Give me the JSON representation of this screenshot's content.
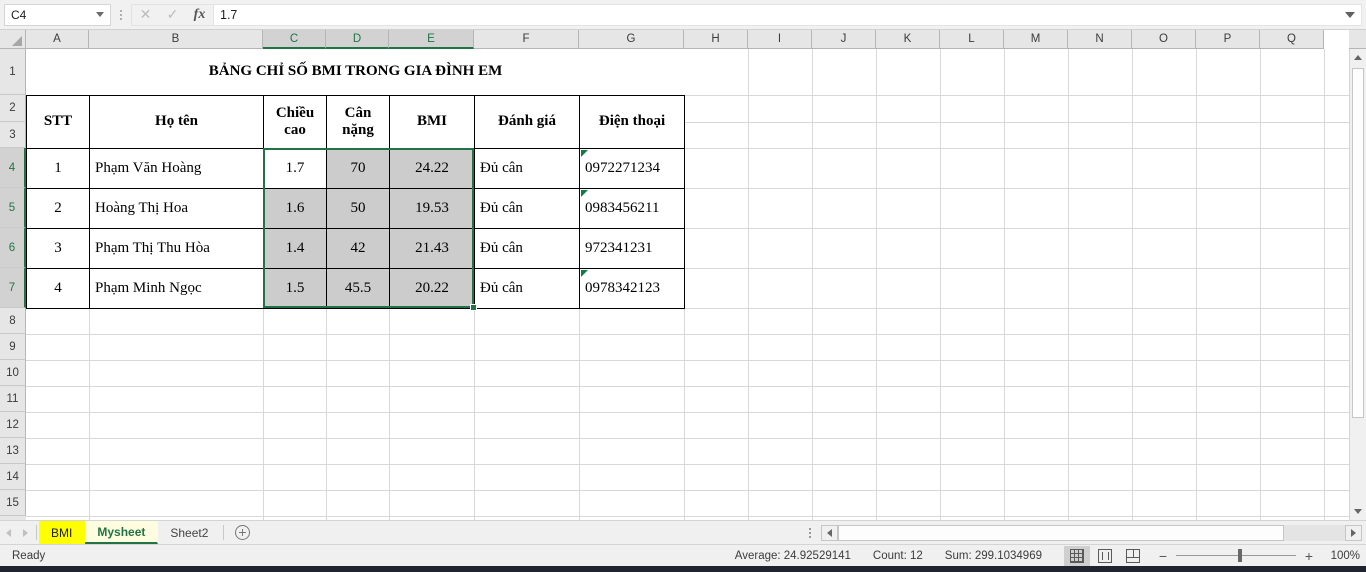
{
  "formula_bar": {
    "name_box_value": "C4",
    "formula_value": "1.7",
    "cancel_icon": "close-icon",
    "confirm_icon": "check-icon",
    "function_icon": "fx-icon"
  },
  "grid": {
    "column_headers": [
      "A",
      "B",
      "C",
      "D",
      "E",
      "F",
      "G",
      "H",
      "I",
      "J",
      "K",
      "L",
      "M",
      "N",
      "O",
      "P",
      "Q"
    ],
    "selected_columns": [
      "C",
      "D",
      "E"
    ],
    "row_headers": [
      "1",
      "2",
      "3",
      "4",
      "5",
      "6",
      "7",
      "8",
      "9",
      "10",
      "11",
      "12",
      "13",
      "14",
      "15"
    ],
    "selected_rows": [
      "4",
      "5",
      "6",
      "7"
    ]
  },
  "sheet": {
    "title": "BẢNG CHỈ SỐ BMI TRONG GIA ĐÌNH EM",
    "headers": [
      "STT",
      "Họ tên",
      "Chiều cao",
      "Cân nặng",
      "BMI",
      "Đánh giá",
      "Điện thoại"
    ],
    "rows": [
      {
        "stt": "1",
        "name": "Phạm Văn Hoàng",
        "height": "1.7",
        "weight": "70",
        "bmi": "24.22",
        "rating": "Đủ cân",
        "phone": "0972271234",
        "phone_error": true
      },
      {
        "stt": "2",
        "name": "Hoàng Thị Hoa",
        "height": "1.6",
        "weight": "50",
        "bmi": "19.53",
        "rating": "Đủ cân",
        "phone": "0983456211",
        "phone_error": true
      },
      {
        "stt": "3",
        "name": "Phạm  Thị Thu Hòa",
        "height": "1.4",
        "weight": "42",
        "bmi": "21.43",
        "rating": "Đủ cân",
        "phone": "972341231",
        "phone_error": false
      },
      {
        "stt": "4",
        "name": "Phạm Minh Ngọc",
        "height": "1.5",
        "weight": "45.5",
        "bmi": "20.22",
        "rating": "Đủ cân",
        "phone": "0978342123",
        "phone_error": true
      }
    ],
    "selection_range": "C4:E7",
    "active_cell": "C4"
  },
  "tabs": {
    "prev_icon": "arrow-left-icon",
    "next_icon": "arrow-right-icon",
    "items": [
      {
        "label": "BMI",
        "state": "colored"
      },
      {
        "label": "Mysheet",
        "state": "active"
      },
      {
        "label": "Sheet2",
        "state": "normal"
      }
    ],
    "add_sheet_icon": "plus-icon"
  },
  "status_bar": {
    "mode": "Ready",
    "average": "Average: 24.92529141",
    "count": "Count: 12",
    "sum": "Sum: 299.1034969",
    "view_normal_icon": "normal-view-icon",
    "view_page_layout_icon": "page-layout-icon",
    "view_page_break_icon": "page-break-icon",
    "zoom_out": "−",
    "zoom_in": "+",
    "zoom_level": "100%"
  },
  "colors": {
    "excel_green": "#217346",
    "tab_yellow": "#ffff00",
    "selection_gray": "#cccccc"
  }
}
